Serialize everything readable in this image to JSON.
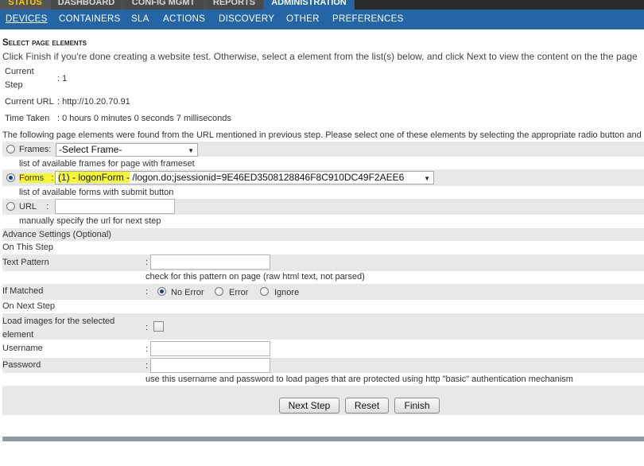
{
  "tabs": [
    {
      "label": "STATUS"
    },
    {
      "label": "DASHBOARD"
    },
    {
      "label": "CONFIG MGMT"
    },
    {
      "label": "REPORTS"
    },
    {
      "label": "ADMINISTRATION"
    }
  ],
  "subnav": [
    {
      "label": "DEVICES"
    },
    {
      "label": "CONTAINERS"
    },
    {
      "label": "SLA"
    },
    {
      "label": "ACTIONS"
    },
    {
      "label": "DISCOVERY"
    },
    {
      "label": "OTHER"
    },
    {
      "label": "PREFERENCES"
    }
  ],
  "page": {
    "title": "Select page elements",
    "intro": "Click Finish if you're done creating a website test. Otherwise, select a element from the list(s) below, and click Next to view the content on the the page"
  },
  "info": {
    "current_step_label_1": "Current",
    "current_step_label_2": "Step",
    "current_step_value": ": 1",
    "current_url_label": "Current URL",
    "current_url_value": ": http://10.20.70.91",
    "time_taken_label": "Time Taken",
    "time_taken_value": ": 0 hours 0 minutes 0 seconds 7 milliseconds"
  },
  "found_text": "The following page elements were found from the URL mentioned in previous step. Please select one of these elements by selecting the appropriate radio button and se",
  "frames": {
    "label": "Frames",
    "colon": ":",
    "selected": "-Select Frame-",
    "hint": "list of available frames for page with frameset"
  },
  "forms": {
    "label": "Forms",
    "colon": ":",
    "selected_highlight": "(1) - logonForm -",
    "selected_rest": " /logon.do;jsessionid=9E46ED3508128846F8C910DC49F2AEE6",
    "hint": "list of available forms with submit button"
  },
  "url": {
    "label": "URL",
    "colon": ":",
    "value": "",
    "hint": "manually specify the url for next step"
  },
  "advance": {
    "heading": "Advance Settings (Optional)",
    "on_this_step": "On This Step",
    "text_pattern_label": "Text Pattern",
    "text_pattern_value": "",
    "text_pattern_hint": "check for this pattern on page (raw html text, not parsed)",
    "if_matched_label": "If Matched",
    "options": [
      "No Error",
      "Error",
      "Ignore"
    ],
    "selected_option": "No Error",
    "on_next_step": "On Next Step",
    "load_images_label_1": "Load images for the selected",
    "load_images_label_2": "element",
    "load_images_checked": false,
    "username_label": "Username",
    "username_value": "",
    "password_label": "Password",
    "password_value": "",
    "auth_hint": "use this username and password to load pages that are protected using http \"basic\" authentication mechanism",
    "colon": ":"
  },
  "buttons": {
    "next": "Next Step",
    "reset": "Reset",
    "finish": "Finish"
  }
}
